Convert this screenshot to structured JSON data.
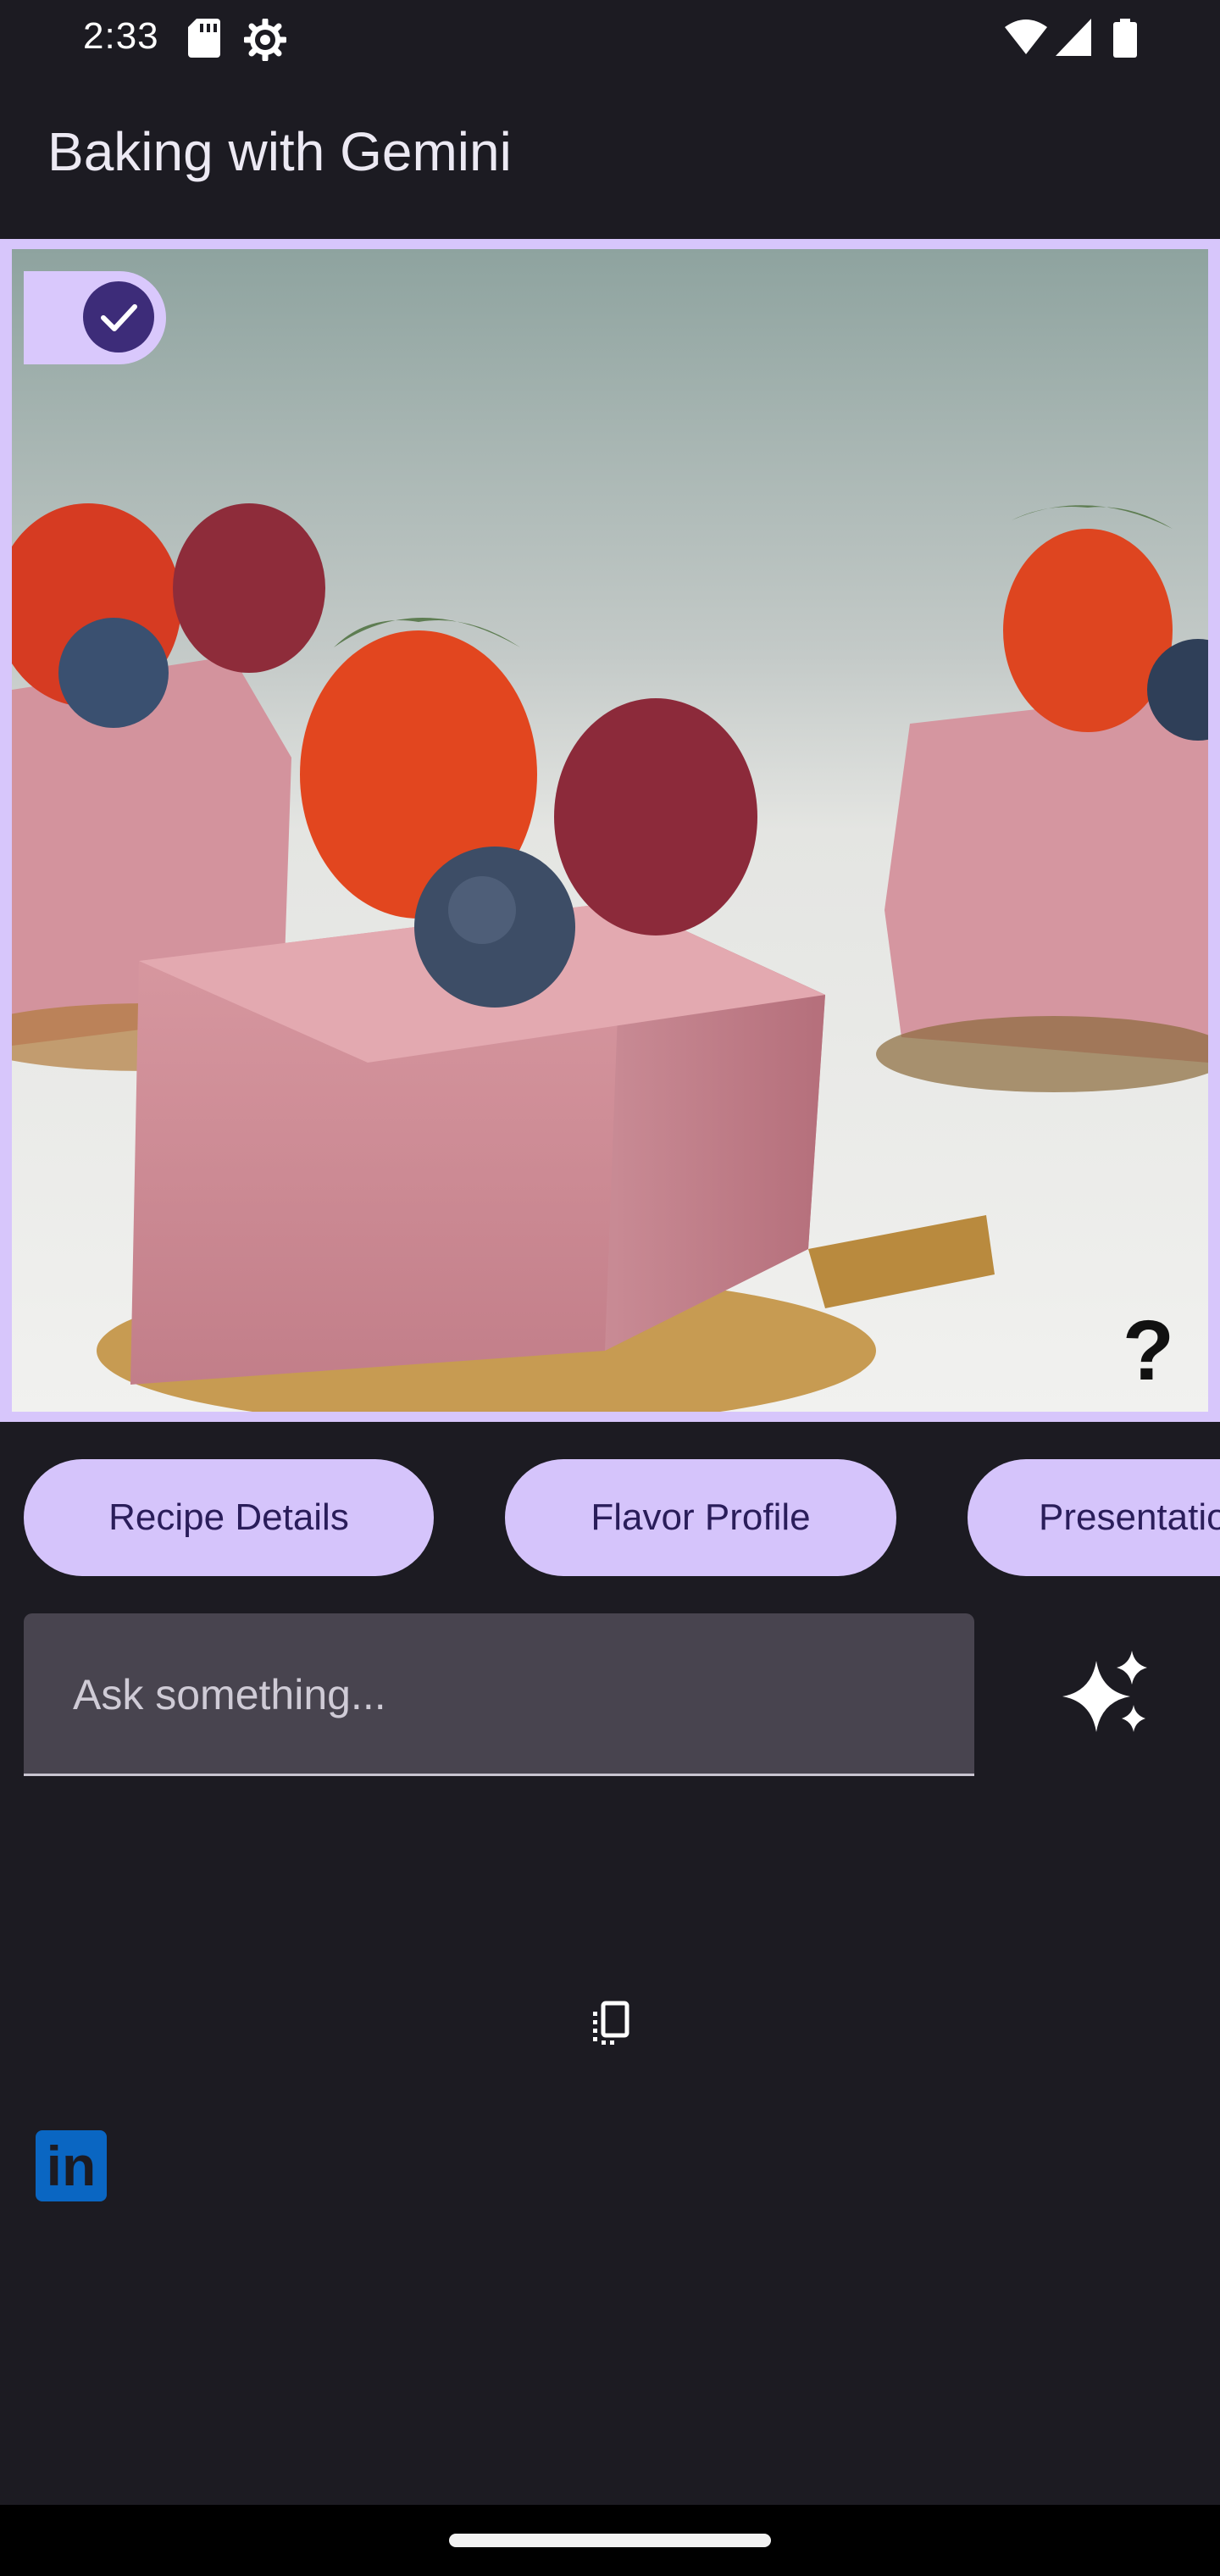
{
  "status_bar": {
    "time": "2:33",
    "icons": [
      "sd-card-icon",
      "settings-gear-icon",
      "wifi-icon",
      "cell-signal-icon",
      "battery-icon"
    ]
  },
  "app_bar": {
    "title": "Baking with Gemini"
  },
  "image_card": {
    "selected": true,
    "help_symbol": "?"
  },
  "suggestion_chips": [
    {
      "label": "Recipe Details"
    },
    {
      "label": "Flavor Profile"
    },
    {
      "label": "Presentation"
    }
  ],
  "prompt_input": {
    "value": "",
    "placeholder": "Ask something..."
  },
  "linkedin": {
    "glyph": "in"
  },
  "colors": {
    "background": "#1c1b22",
    "chip": "#d5c4fb",
    "chip_text": "#2a1d5a",
    "frame": "#d7c6fb",
    "check_circle": "#3d2c79",
    "input_background": "#48444f",
    "linkedin": "#0a66c2"
  }
}
